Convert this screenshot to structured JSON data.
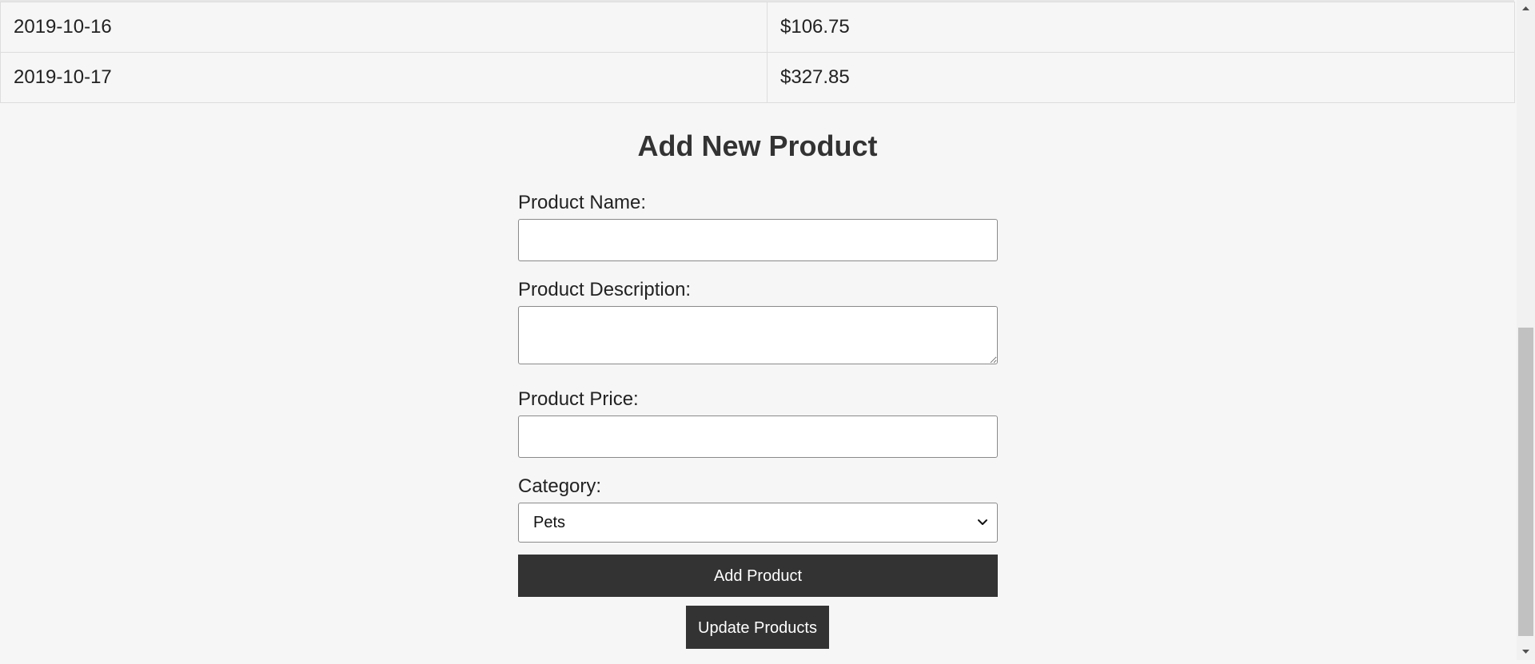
{
  "sales_table": {
    "rows": [
      {
        "date": "2019-10-16",
        "amount": "$106.75"
      },
      {
        "date": "2019-10-17",
        "amount": "$327.85"
      }
    ]
  },
  "add_product_form": {
    "title": "Add New Product",
    "name_label": "Product Name:",
    "name_value": "",
    "description_label": "Product Description:",
    "description_value": "",
    "price_label": "Product Price:",
    "price_value": "",
    "category_label": "Category:",
    "category_selected": "Pets",
    "submit_label": "Add Product"
  },
  "update_button_label": "Update Products",
  "icons": {
    "select_caret": "chevron-down-icon",
    "scroll_up": "triangle-up-icon",
    "scroll_down": "triangle-down-icon"
  },
  "colors": {
    "page_background": "#f6f6f6",
    "button_background": "#333333",
    "button_text": "#ffffff",
    "table_border": "#dddddd",
    "scroll_thumb": "#c1c1c1"
  }
}
